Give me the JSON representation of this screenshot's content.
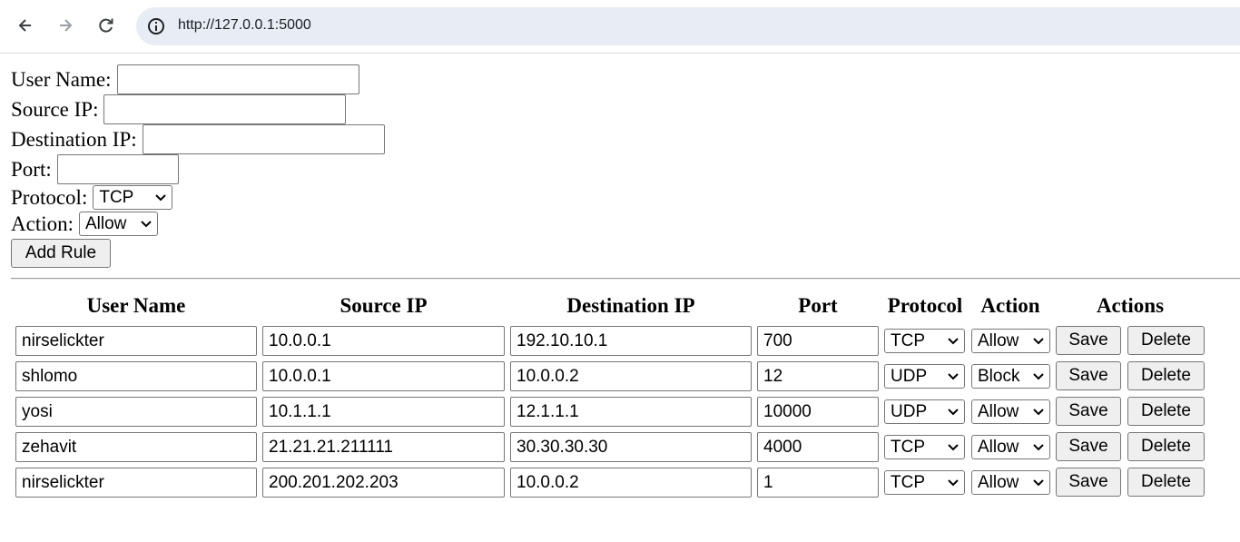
{
  "browser": {
    "url": "http://127.0.0.1:5000"
  },
  "form": {
    "user_name_label": "User Name:",
    "source_ip_label": "Source IP:",
    "destination_ip_label": "Destination IP:",
    "port_label": "Port:",
    "protocol_label": "Protocol:",
    "protocol_value": "TCP",
    "action_label": "Action:",
    "action_value": "Allow",
    "add_rule_label": "Add Rule"
  },
  "table": {
    "headers": [
      "User Name",
      "Source IP",
      "Destination IP",
      "Port",
      "Protocol",
      "Action",
      "Actions"
    ],
    "save_label": "Save",
    "delete_label": "Delete",
    "rows": [
      {
        "user": "nirselickter",
        "src": "10.0.0.1",
        "dst": "192.10.10.1",
        "port": "700",
        "protocol": "TCP",
        "action": "Allow"
      },
      {
        "user": "shlomo",
        "src": "10.0.0.1",
        "dst": "10.0.0.2",
        "port": "12",
        "protocol": "UDP",
        "action": "Block"
      },
      {
        "user": "yosi",
        "src": "10.1.1.1",
        "dst": "12.1.1.1",
        "port": "10000",
        "protocol": "UDP",
        "action": "Allow"
      },
      {
        "user": "zehavit",
        "src": "21.21.21.211111",
        "dst": "30.30.30.30",
        "port": "4000",
        "protocol": "TCP",
        "action": "Allow"
      },
      {
        "user": "nirselickter",
        "src": "200.201.202.203",
        "dst": "10.0.0.2",
        "port": "1",
        "protocol": "TCP",
        "action": "Allow"
      }
    ]
  }
}
